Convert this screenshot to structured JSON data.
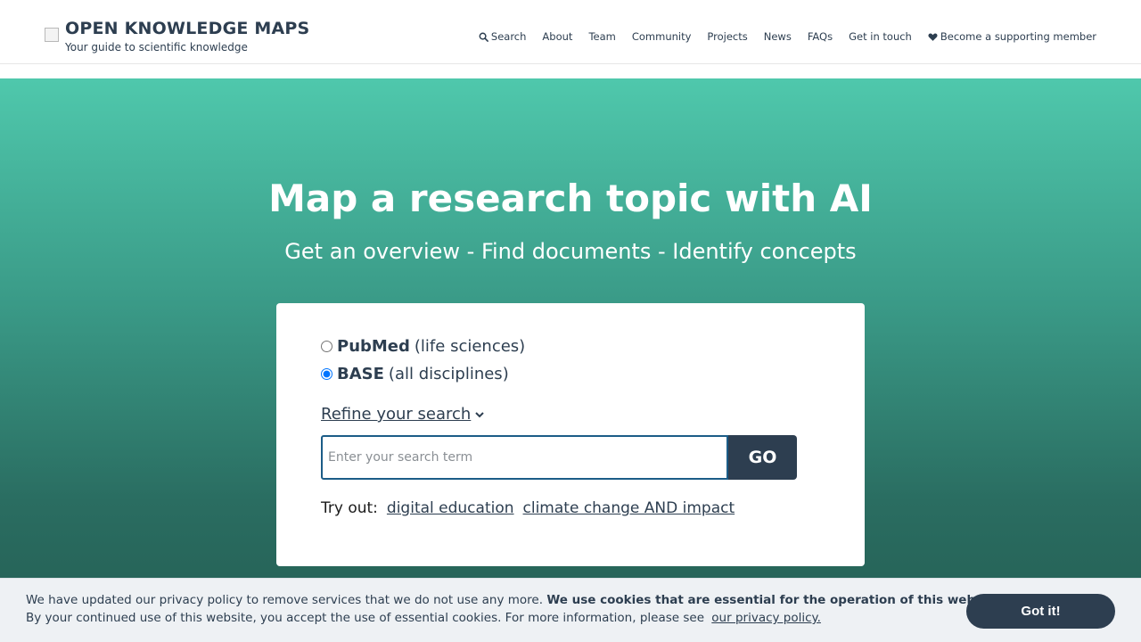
{
  "header": {
    "title": "OPEN KNOWLEDGE MAPS",
    "subtitle": "Your guide to scientific knowledge",
    "nav": [
      {
        "label": "Search",
        "icon": "search-icon"
      },
      {
        "label": "About"
      },
      {
        "label": "Team"
      },
      {
        "label": "Community"
      },
      {
        "label": "Projects"
      },
      {
        "label": "News"
      },
      {
        "label": "FAQs"
      },
      {
        "label": "Get in touch"
      },
      {
        "label": "Become a supporting member",
        "icon": "heart-icon"
      }
    ]
  },
  "hero": {
    "title": "Map a research topic with AI",
    "subtitle": "Get an overview - Find documents - Identify concepts"
  },
  "search": {
    "sources": [
      {
        "name": "PubMed",
        "desc": "(life sciences)",
        "selected": false
      },
      {
        "name": "BASE",
        "desc": "(all disciplines)",
        "selected": true
      }
    ],
    "refine_label": "Refine your search",
    "placeholder": "Enter your search term",
    "go_label": "GO",
    "tryout_label": "Try out:",
    "examples": [
      "digital education",
      "climate change AND impact"
    ]
  },
  "cookie": {
    "line1_normal": "We have updated our privacy policy to remove services that we do not use any more.",
    "line1_bold": "We use cookies that are essential for the operation of this website.",
    "line2": "By your continued use of this website, you accept the use of essential cookies. For more information, please see",
    "link": "our privacy policy.",
    "button": "Got it!"
  },
  "colors": {
    "brand_dark": "#2d3e50",
    "hero_top": "#4fc8ac",
    "hero_bottom": "#245e53",
    "input_border": "#1c5c87"
  }
}
